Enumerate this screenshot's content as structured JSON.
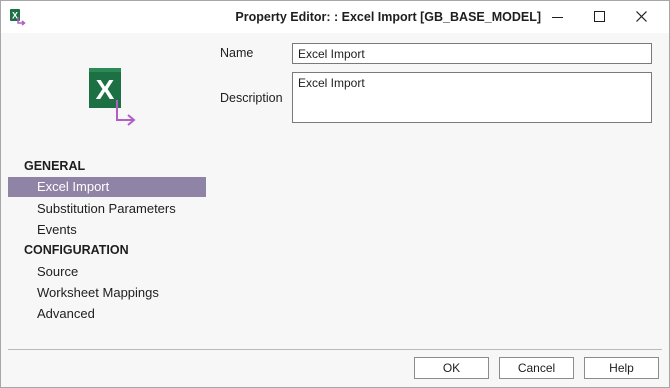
{
  "window": {
    "title": "Property Editor: : Excel Import [GB_BASE_MODEL]",
    "app_icon": "excel-import-icon",
    "controls": [
      "minimize-icon",
      "maximize-icon",
      "close-icon"
    ]
  },
  "logo": {
    "icon": "excel-import-logo",
    "letter": "X",
    "colors": {
      "green": "#1d7044",
      "arrow": "#b05fc3"
    }
  },
  "nav": {
    "general_heading": "GENERAL",
    "general_items": [
      {
        "label": "Excel Import",
        "selected": true
      },
      {
        "label": "Substitution Parameters",
        "selected": false
      },
      {
        "label": "Events",
        "selected": false
      }
    ],
    "configuration_heading": "CONFIGURATION",
    "configuration_items": [
      {
        "label": "Source",
        "selected": false
      },
      {
        "label": "Worksheet Mappings",
        "selected": false
      },
      {
        "label": "Advanced",
        "selected": false
      }
    ],
    "selected_color": "#8f83a6"
  },
  "form": {
    "name_label": "Name",
    "name_value": "Excel Import",
    "description_label": "Description",
    "description_value": "Excel Import"
  },
  "buttons": {
    "ok": "OK",
    "cancel": "Cancel",
    "help": "Help"
  }
}
